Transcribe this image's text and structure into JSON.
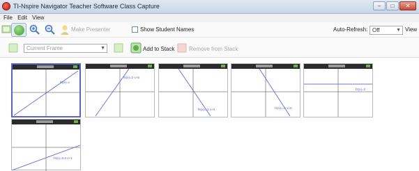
{
  "window": {
    "title": "TI-Nspire Navigator Teacher Software Class Capture",
    "controls": [
      "–",
      "□",
      "✕"
    ]
  },
  "menu": [
    "File",
    "Edit",
    "View"
  ],
  "toolbar": {
    "make_presenter": "Make Presenter",
    "show_student_names": "Show Student Names",
    "auto_refresh_label": "Auto-Refresh:",
    "auto_refresh_value": "Off",
    "view_label": "View"
  },
  "toolbar2": {
    "frame_select": "Current Frame",
    "add_to_stack": "Add to Stack",
    "remove_from_stack": "Remove from Stack"
  },
  "screens": [
    {
      "label": "f6(x)=x",
      "slope": "positive"
    },
    {
      "label": "f5(x)=2·x+5",
      "slope": "steep-positive"
    },
    {
      "label": "f6(x)=-2·x+5",
      "slope": "negative"
    },
    {
      "label": "f4(x)=-2·x+5",
      "slope": "steep-negative"
    },
    {
      "label": "f2(x)=2",
      "slope": "horizontal"
    },
    {
      "label": "f4(x)=0.5·x+1",
      "slope": "positive"
    }
  ],
  "accent_color": "#5b63c9"
}
